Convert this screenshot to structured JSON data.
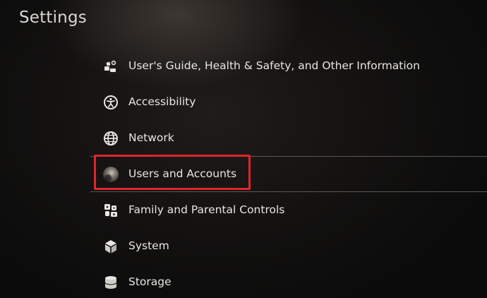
{
  "page": {
    "title": "Settings"
  },
  "menu": {
    "items": [
      {
        "label": "User's Guide, Health & Safety, and Other Information",
        "icon": "guide-icon"
      },
      {
        "label": "Accessibility",
        "icon": "accessibility-icon"
      },
      {
        "label": "Network",
        "icon": "globe-icon"
      },
      {
        "label": "Users and Accounts",
        "icon": "avatar-icon",
        "selected": true
      },
      {
        "label": "Family and Parental Controls",
        "icon": "family-icon"
      },
      {
        "label": "System",
        "icon": "cube-icon"
      },
      {
        "label": "Storage",
        "icon": "storage-icon"
      }
    ]
  },
  "colors": {
    "highlight_border": "#e3232b",
    "text": "#e8e5e2",
    "background": "#121110"
  }
}
